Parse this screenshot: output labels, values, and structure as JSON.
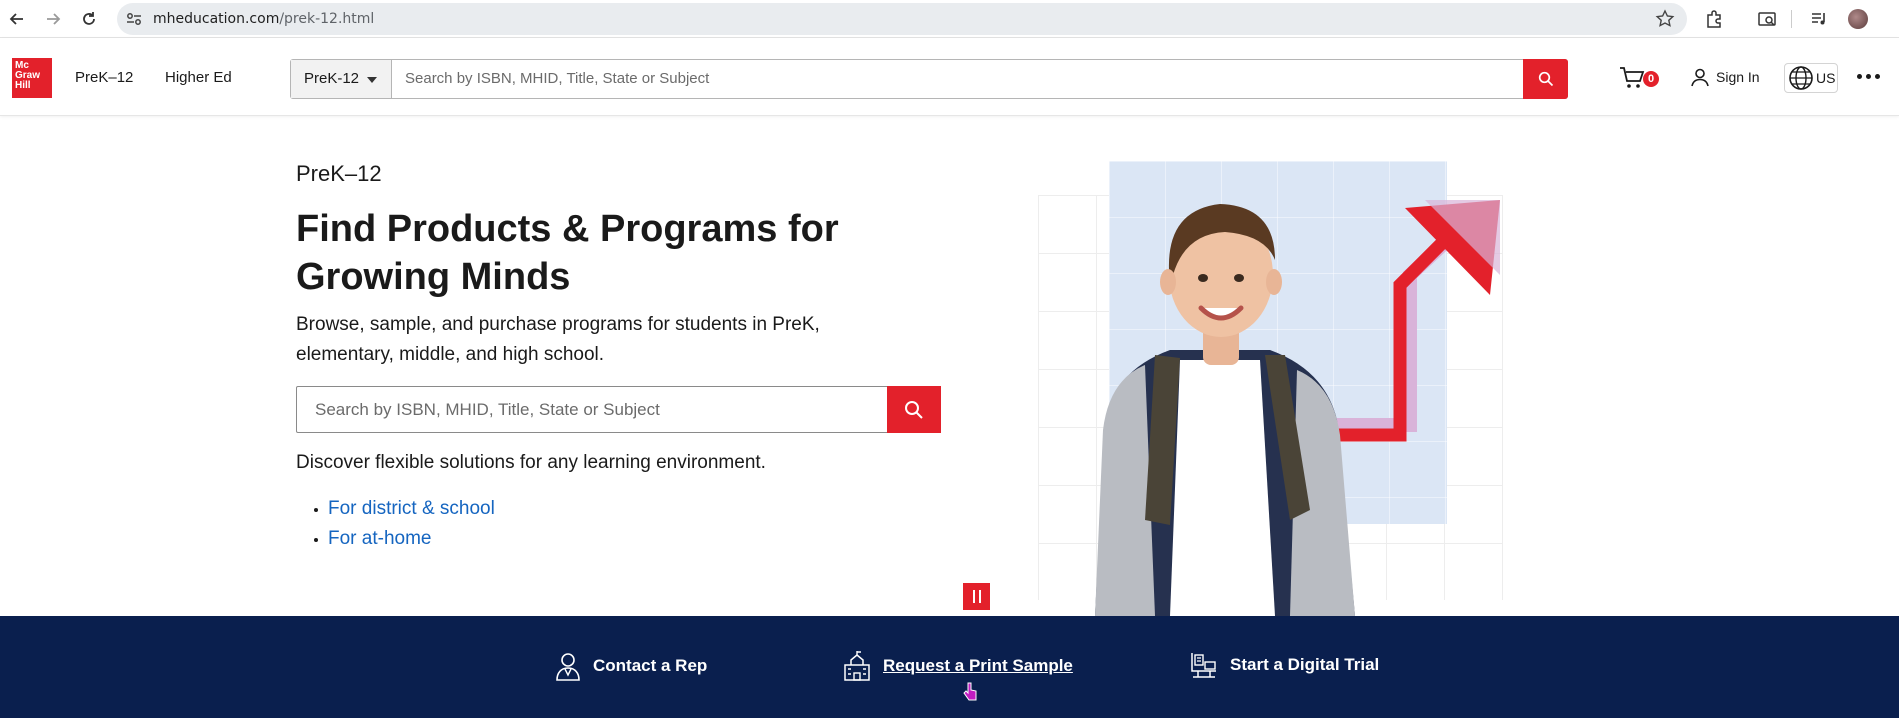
{
  "browser": {
    "url_host": "mheducation.com",
    "url_path": "/prek-12.html"
  },
  "header": {
    "logo_lines": [
      "Mc",
      "Graw",
      "Hill"
    ],
    "nav": [
      "PreK–12",
      "Higher Ed"
    ],
    "search_scope": "PreK-12",
    "search_placeholder": "Search by ISBN, MHID, Title, State or Subject",
    "cart_count": "0",
    "sign_in": "Sign In",
    "region": "US"
  },
  "hero": {
    "eyebrow": "PreK–12",
    "title": "Find Products & Programs for Growing Minds",
    "description": "Browse, sample, and purchase programs for students in PreK, elementary, middle, and high school.",
    "search_placeholder": "Search by ISBN, MHID, Title, State or Subject",
    "discover": "Discover flexible solutions for any learning environment.",
    "links": [
      "For district & school",
      "For at-home"
    ]
  },
  "cta_bar": {
    "items": [
      "Contact a Rep",
      "Request a Print Sample",
      "Start a Digital Trial"
    ]
  },
  "colors": {
    "brand_red": "#e3212b",
    "navy": "#0a1f4e",
    "link_blue": "#1565c0"
  }
}
